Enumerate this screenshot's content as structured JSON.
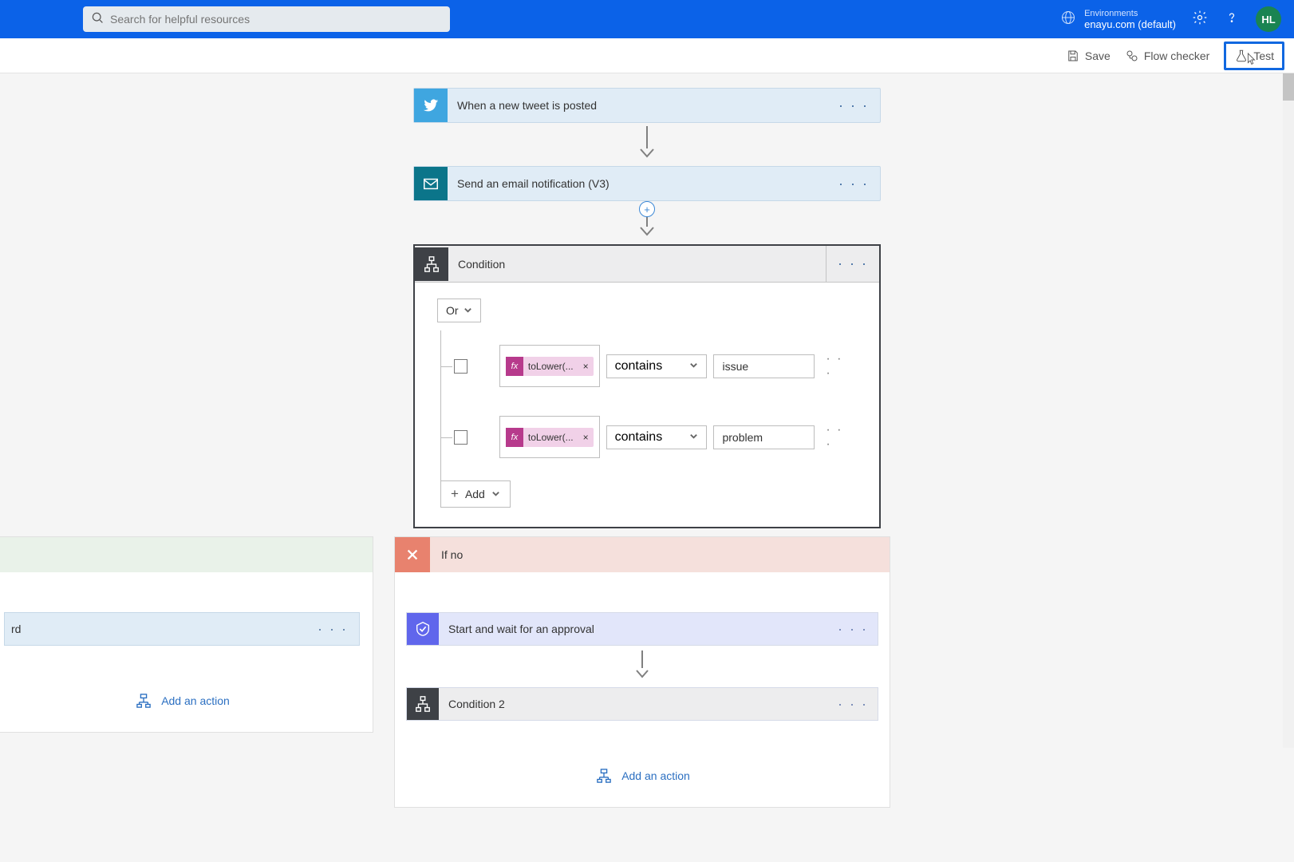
{
  "header": {
    "search_placeholder": "Search for helpful resources",
    "env_label": "Environments",
    "env_name": "enayu.com (default)",
    "avatar": "HL"
  },
  "toolbar": {
    "save": "Save",
    "flow_checker": "Flow checker",
    "test": "Test"
  },
  "flow": {
    "trigger": {
      "title": "When a new tweet is posted"
    },
    "email": {
      "title": "Send an email notification (V3)"
    },
    "condition": {
      "title": "Condition",
      "op": "Or",
      "add": "Add",
      "rules": [
        {
          "expr": "toLower(...",
          "operator": "contains",
          "value": "issue"
        },
        {
          "expr": "toLower(...",
          "operator": "contains",
          "value": "problem"
        }
      ]
    },
    "yes": {
      "card": {
        "title": "rd"
      },
      "add_action": "Add an action"
    },
    "no": {
      "title": "If no",
      "approval": {
        "title": "Start and wait for an approval"
      },
      "condition2": {
        "title": "Condition 2"
      },
      "add_action": "Add an action"
    }
  }
}
